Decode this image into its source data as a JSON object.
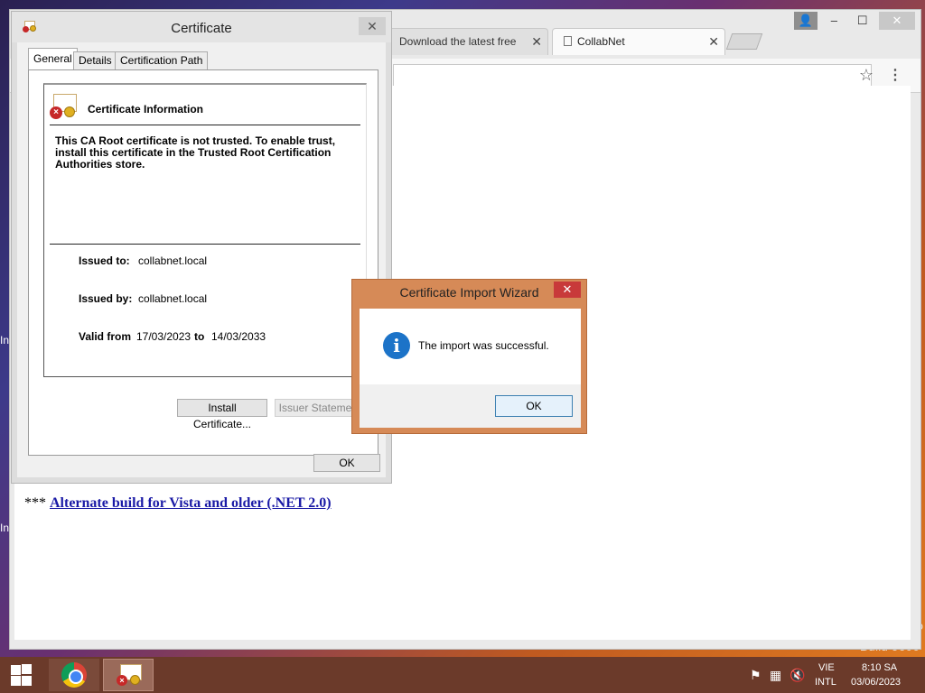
{
  "desktop": {
    "build_text": "Build 9600",
    "left_text_1": "In",
    "left_text_2": "In",
    "right_text_1": "o"
  },
  "browser": {
    "tabs": [
      {
        "label": "Download the latest free",
        "active": false
      },
      {
        "label": "CollabNet",
        "active": true
      }
    ],
    "tab_close_glyph": "✕",
    "omnibox_value": "",
    "page": {
      "prefix": "*** ",
      "link_text": "Alternate build for Vista and older (.NET 2.0)"
    }
  },
  "certificate_dialog": {
    "title": "Certificate",
    "close_glyph": "✕",
    "tabs": [
      "General",
      "Details",
      "Certification Path"
    ],
    "active_tab": "General",
    "heading": "Certificate Information",
    "warning": "This CA Root certificate is not trusted. To enable trust, install this certificate in the Trusted Root Certification Authorities store.",
    "issued_to_label": "Issued to:",
    "issued_to_value": "collabnet.local",
    "issued_by_label": "Issued by:",
    "issued_by_value": "collabnet.local",
    "valid_from_label": "Valid from",
    "valid_from_value": "17/03/2023",
    "valid_to_label": "to",
    "valid_to_value": "14/03/2033",
    "install_button": "Install Certificate...",
    "issuer_button": "Issuer Statement",
    "ok_button": "OK"
  },
  "import_wizard": {
    "title": "Certificate Import Wizard",
    "close_glyph": "✕",
    "message": "The import was successful.",
    "info_glyph": "i",
    "ok_button": "OK"
  },
  "taskbar": {
    "lang_day": "VIE",
    "lang_layout": "INTL",
    "time": "8:10 SA",
    "date": "03/06/2023"
  },
  "colors": {
    "wizard_frame": "#d68a57",
    "info_icon": "#1c73c8",
    "link": "#1a1aa6",
    "taskbar": "#6b3a2a"
  }
}
